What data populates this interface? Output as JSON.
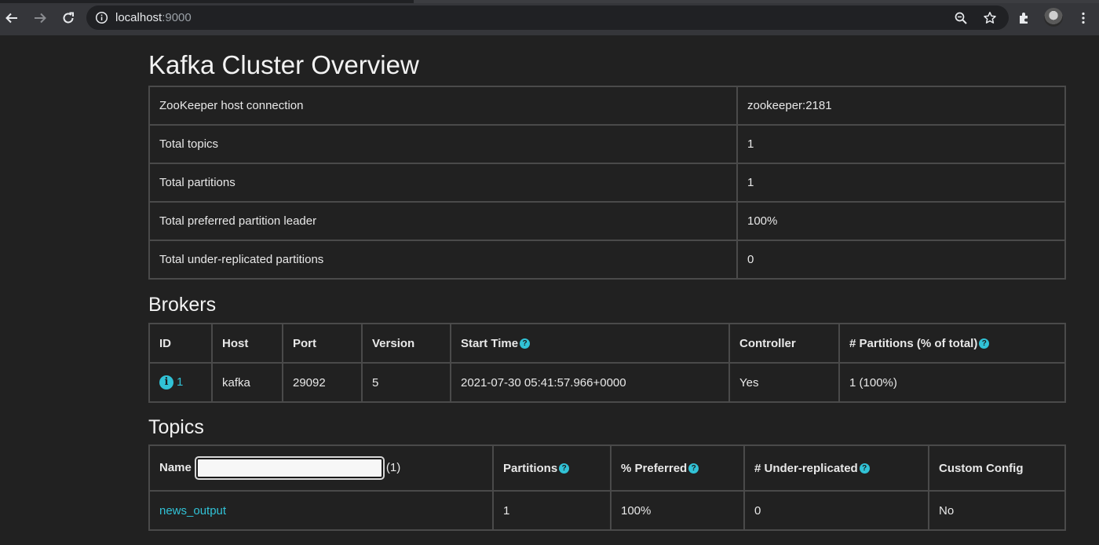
{
  "browser": {
    "url_host": "localhost",
    "url_port": ":9000",
    "icons": [
      "back-arrow-icon",
      "forward-arrow-icon",
      "reload-icon",
      "info-icon",
      "zoom-icon",
      "star-icon",
      "extensions-icon"
    ]
  },
  "page": {
    "title": "Kafka Cluster Overview"
  },
  "overview": {
    "rows": [
      {
        "label": "ZooKeeper host connection",
        "value": "zookeeper:2181"
      },
      {
        "label": "Total topics",
        "value": "1"
      },
      {
        "label": "Total partitions",
        "value": "1"
      },
      {
        "label": "Total preferred partition leader",
        "value": "100%"
      },
      {
        "label": "Total under-replicated partitions",
        "value": "0"
      }
    ]
  },
  "brokers": {
    "heading": "Brokers",
    "columns": {
      "id": "ID",
      "host": "Host",
      "port": "Port",
      "version": "Version",
      "start_time": "Start Time",
      "controller": "Controller",
      "partitions": "# Partitions (% of total)"
    },
    "rows": [
      {
        "id": "1",
        "host": "kafka",
        "port": "29092",
        "version": "5",
        "start_time": "2021-07-30 05:41:57.966+0000",
        "controller": "Yes",
        "partitions": "1 (100%)"
      }
    ]
  },
  "topics": {
    "heading": "Topics",
    "columns": {
      "name": "Name",
      "name_count": "(1)",
      "partitions": "Partitions",
      "preferred": "% Preferred",
      "under_replicated": "# Under-replicated",
      "custom_config": "Custom Config"
    },
    "filter_value": "",
    "rows": [
      {
        "name": "news_output",
        "partitions": "1",
        "preferred": "100%",
        "under_replicated": "0",
        "custom_config": "No"
      }
    ]
  },
  "colors": {
    "background": "#212121",
    "accent": "#31c2d6",
    "border": "#4a4a4a"
  }
}
